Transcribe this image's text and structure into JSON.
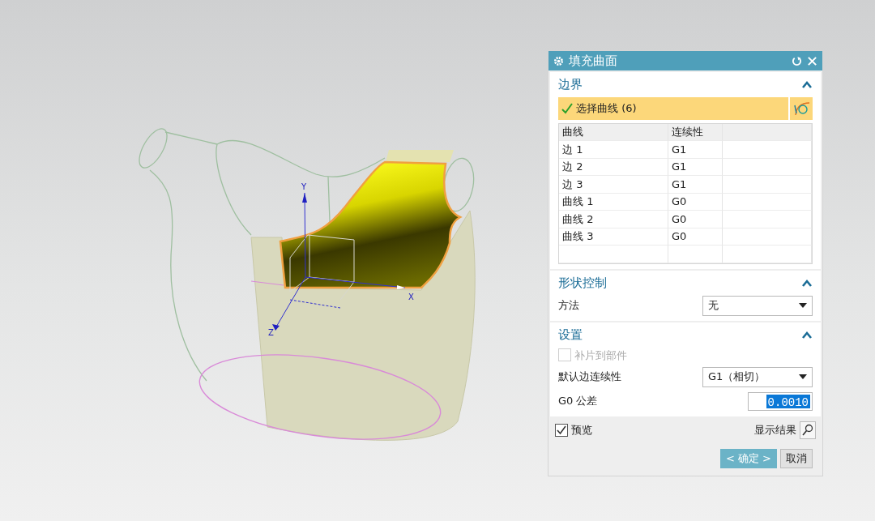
{
  "viewport": {
    "axis_labels": [
      "Y",
      "X",
      "Z"
    ]
  },
  "dialog": {
    "title": "填充曲面",
    "boundary": {
      "title": "边界",
      "expanded": true,
      "selector": {
        "label": "选择曲线 (6)",
        "done": true
      },
      "columns": [
        "曲线",
        "连续性"
      ],
      "rows": [
        {
          "curve": "边 1",
          "continuity": "G1"
        },
        {
          "curve": "边 2",
          "continuity": "G1"
        },
        {
          "curve": "边 3",
          "continuity": "G1"
        },
        {
          "curve": "曲线 1",
          "continuity": "G0"
        },
        {
          "curve": "曲线 2",
          "continuity": "G0"
        },
        {
          "curve": "曲线 3",
          "continuity": "G0"
        }
      ]
    },
    "shape": {
      "title": "形状控制",
      "expanded": true,
      "method_label": "方法",
      "method_value": "无"
    },
    "settings": {
      "title": "设置",
      "expanded": true,
      "patch": {
        "label": "补片到部件",
        "checked": false,
        "disabled": true
      },
      "continuity_label": "默认边连续性",
      "continuity_value": "G1（相切）",
      "tolerance_label": "G0 公差",
      "tolerance_value": "0.0010",
      "tolerance_selected": true
    },
    "preview": {
      "label": "预览",
      "checked": true
    },
    "show_result": "显示结果",
    "buttons": [
      {
        "label": "< 确定 >",
        "kind": "primary"
      },
      {
        "label": "取消",
        "kind": "secondary"
      }
    ]
  }
}
